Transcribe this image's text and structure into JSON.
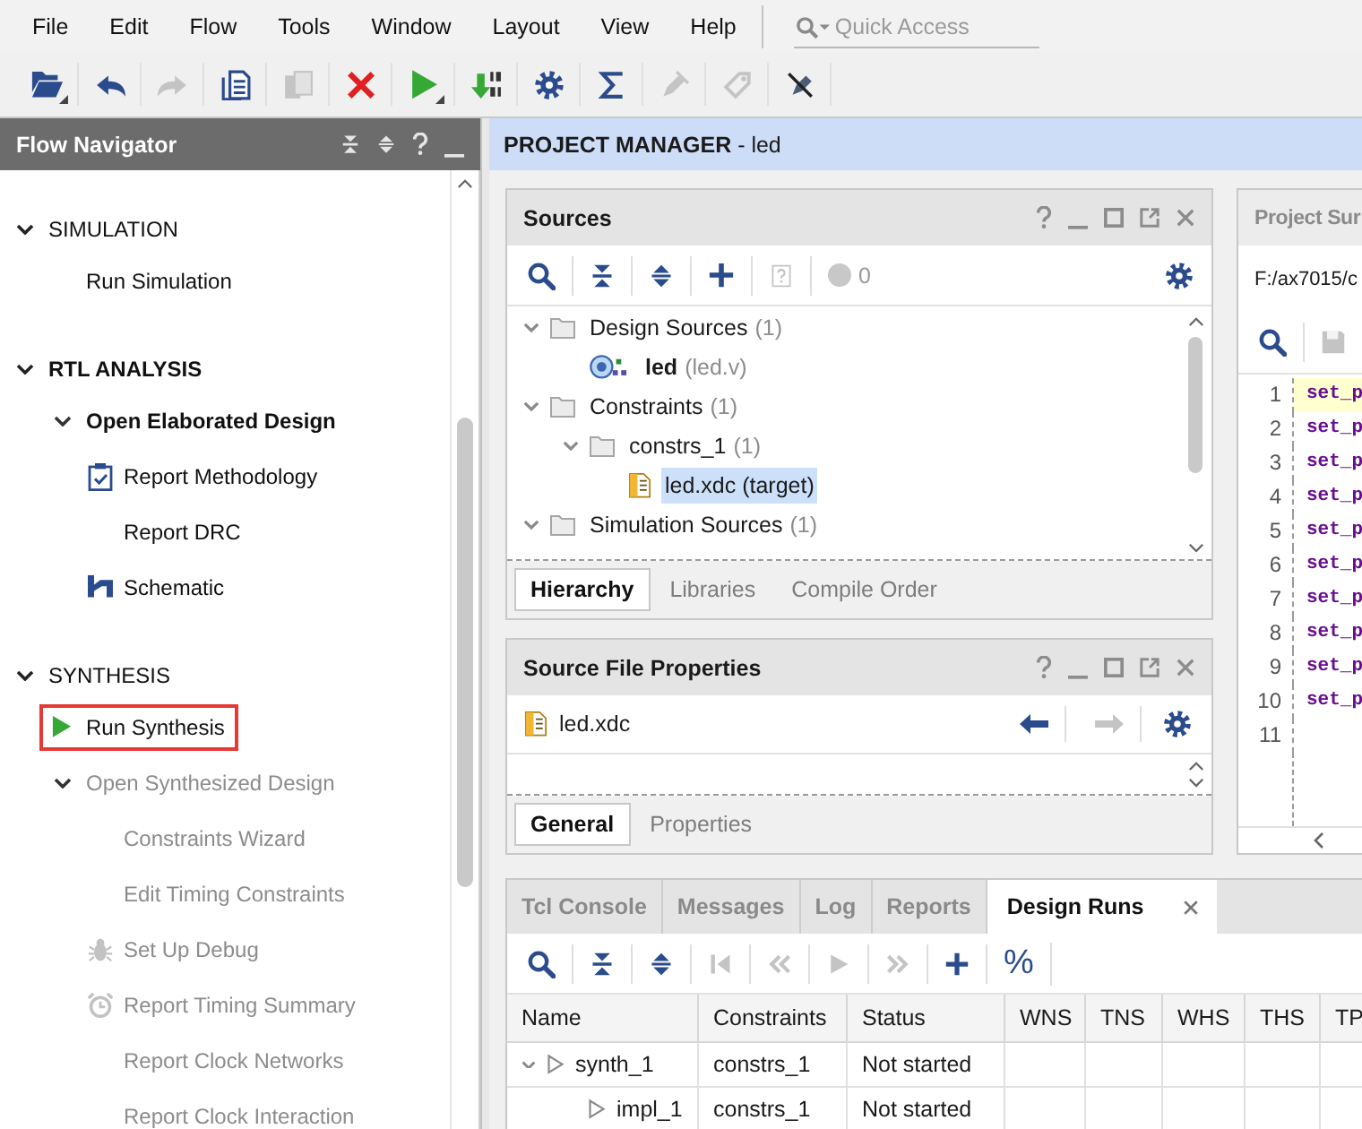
{
  "menu_bar": {
    "items": [
      "File",
      "Edit",
      "Flow",
      "Tools",
      "Window",
      "Layout",
      "View",
      "Help"
    ],
    "search": {
      "placeholder": "Quick Access"
    }
  },
  "toolbar": {
    "buttons": [
      {
        "disabled": false,
        "dropdown": true
      },
      {
        "disabled": false,
        "dropdown": false
      },
      {
        "disabled": true,
        "dropdown": false
      },
      {
        "disabled": false,
        "dropdown": false
      },
      {
        "disabled": true,
        "dropdown": false
      },
      {
        "disabled": false,
        "dropdown": false
      },
      {
        "disabled": false,
        "dropdown": true
      },
      {
        "disabled": false,
        "dropdown": false
      },
      {
        "disabled": false,
        "dropdown": false
      },
      {
        "disabled": false,
        "dropdown": false
      },
      {
        "disabled": true,
        "dropdown": false
      },
      {
        "disabled": true,
        "dropdown": false
      },
      {
        "disabled": false,
        "dropdown": false
      }
    ]
  },
  "flow_navigator": {
    "title": "Flow Navigator",
    "sections": [
      {
        "label": "SIMULATION",
        "expanded": true,
        "active": false,
        "children": [
          {
            "label": "Run Simulation",
            "disabled": false,
            "active": false,
            "highlighted": false
          }
        ]
      },
      {
        "label": "RTL ANALYSIS",
        "expanded": true,
        "active": true,
        "children": [
          {
            "label": "Open Elaborated Design",
            "disabled": false,
            "active": true,
            "highlighted": false,
            "expanded": true,
            "children": [
              {
                "label": "Report Methodology",
                "disabled": false,
                "active": false,
                "highlighted": false
              },
              {
                "label": "Report DRC",
                "disabled": false,
                "active": false,
                "highlighted": false
              },
              {
                "label": "Schematic",
                "disabled": false,
                "active": false,
                "highlighted": false
              }
            ]
          }
        ]
      },
      {
        "label": "SYNTHESIS",
        "expanded": true,
        "active": false,
        "children": [
          {
            "label": "Run Synthesis",
            "disabled": false,
            "active": false,
            "highlighted": true
          },
          {
            "label": "Open Synthesized Design",
            "disabled": true,
            "active": false,
            "highlighted": false,
            "expanded": true,
            "children": [
              {
                "label": "Constraints Wizard",
                "disabled": true,
                "active": false,
                "highlighted": false
              },
              {
                "label": "Edit Timing Constraints",
                "disabled": true,
                "active": false,
                "highlighted": false
              },
              {
                "label": "Set Up Debug",
                "disabled": true,
                "active": false,
                "highlighted": false
              },
              {
                "label": "Report Timing Summary",
                "disabled": true,
                "active": false,
                "highlighted": false
              },
              {
                "label": "Report Clock Networks",
                "disabled": true,
                "active": false,
                "highlighted": false
              },
              {
                "label": "Report Clock Interaction",
                "disabled": true,
                "active": false,
                "highlighted": false
              }
            ]
          }
        ]
      }
    ]
  },
  "project_manager": {
    "title": "**PROJECT MANAGER** - led"
  },
  "sources": {
    "title": "Sources",
    "issue_count": "0",
    "tree": [
      {
        "kind": "folder",
        "label": "Design Sources",
        "count": "(1)",
        "expanded": true,
        "selected": false,
        "children": [
          {
            "kind": "module",
            "label": "led",
            "detail": "(led.v)",
            "selected": false
          }
        ]
      },
      {
        "kind": "folder",
        "label": "Constraints",
        "count": "(1)",
        "expanded": true,
        "selected": false,
        "children": [
          {
            "kind": "folder",
            "label": "constrs_1",
            "count": "(1)",
            "expanded": true,
            "selected": false,
            "children": [
              {
                "kind": "constraint",
                "label": "led.xdc (target)",
                "selected": true
              }
            ]
          }
        ]
      },
      {
        "kind": "folder",
        "label": "Simulation Sources",
        "count": "(1)",
        "expanded": true,
        "selected": false
      }
    ],
    "tabs": [
      {
        "label": "Hierarchy",
        "selected": true
      },
      {
        "label": "Libraries",
        "selected": false
      },
      {
        "label": "Compile Order",
        "selected": false
      }
    ]
  },
  "source_file_properties": {
    "title": "Source File Properties",
    "file": "led.xdc",
    "back_disabled": false,
    "forward_disabled": true,
    "tabs": [
      {
        "label": "General",
        "selected": true
      },
      {
        "label": "Properties",
        "selected": false
      }
    ]
  },
  "project_summary": {
    "title": "Project Sur",
    "path": "F:/ax7015/c",
    "lines": [
      {
        "number": "1",
        "code": "set_p",
        "selected": true
      },
      {
        "number": "2",
        "code": "set_p",
        "selected": false
      },
      {
        "number": "3",
        "code": "set_p",
        "selected": false
      },
      {
        "number": "4",
        "code": "set_p",
        "selected": false
      },
      {
        "number": "5",
        "code": "set_p",
        "selected": false
      },
      {
        "number": "6",
        "code": "set_p",
        "selected": false
      },
      {
        "number": "7",
        "code": "set_p",
        "selected": false
      },
      {
        "number": "8",
        "code": "set_p",
        "selected": false
      },
      {
        "number": "9",
        "code": "set_p",
        "selected": false
      },
      {
        "number": "10",
        "code": "set_p",
        "selected": false
      },
      {
        "number": "11",
        "selected": false
      }
    ]
  },
  "bottom_panel": {
    "tabs": [
      {
        "label": "Tcl Console",
        "selected": false
      },
      {
        "label": "Messages",
        "selected": false
      },
      {
        "label": "Log",
        "selected": false
      },
      {
        "label": "Reports",
        "selected": false
      },
      {
        "label": "Design Runs",
        "selected": true
      }
    ],
    "toolbar": {
      "buttons": [
        {
          "disabled": false
        },
        {
          "disabled": false
        },
        {
          "disabled": false
        },
        {
          "disabled": true
        },
        {
          "disabled": true
        },
        {
          "disabled": true
        },
        {
          "disabled": true
        },
        {
          "disabled": false
        },
        {
          "disabled": false,
          "label": "%"
        }
      ]
    },
    "table": {
      "columns": [
        "Name",
        "Constraints",
        "Status",
        "WNS",
        "TNS",
        "WHS",
        "THS",
        "TP"
      ],
      "rows": [
        {
          "name": "synth_1",
          "constraints": "constrs_1",
          "status": "Not started",
          "selected": false,
          "expanded": true,
          "children": [
            {
              "name": "impl_1",
              "constraints": "constrs_1",
              "status": "Not started",
              "selected": false
            }
          ]
        }
      ]
    }
  }
}
